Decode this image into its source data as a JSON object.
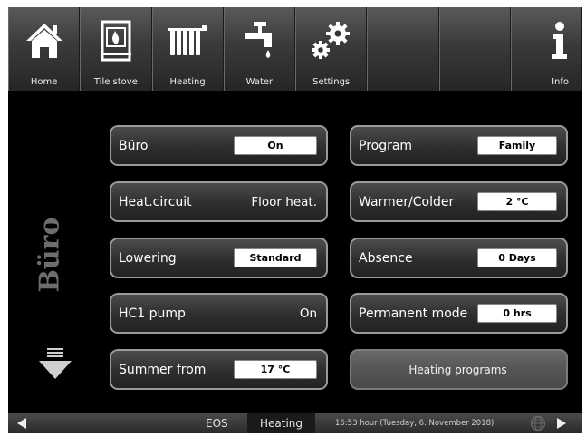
{
  "nav": {
    "items": [
      {
        "label": "Home",
        "icon": "home-icon"
      },
      {
        "label": "Tile stove",
        "icon": "tile-stove-icon"
      },
      {
        "label": "Heating",
        "icon": "radiator-icon"
      },
      {
        "label": "Water",
        "icon": "water-tap-icon"
      },
      {
        "label": "Settings",
        "icon": "gears-icon"
      },
      {
        "label": "",
        "icon": ""
      },
      {
        "label": "",
        "icon": ""
      },
      {
        "label": "Info",
        "icon": "info-icon"
      }
    ]
  },
  "room": {
    "name": "Büro"
  },
  "left_tiles": [
    {
      "label": "Büro",
      "value": "On"
    },
    {
      "label": "Heat.circuit",
      "value": "Floor heat."
    },
    {
      "label": "Lowering",
      "value": "Standard"
    },
    {
      "label": "HC1 pump",
      "value": "On"
    },
    {
      "label": "Summer from",
      "value": "17 °C"
    }
  ],
  "right_tiles": [
    {
      "label": "Program",
      "value": "Family"
    },
    {
      "label": "Warmer/Colder",
      "value": "2 °C"
    },
    {
      "label": "Absence",
      "value": "0 Days"
    },
    {
      "label": "Permanent mode",
      "value": "0 hrs"
    }
  ],
  "action": {
    "label": "Heating programs"
  },
  "status_bar": {
    "eos": "EOS",
    "active_tab": "Heating",
    "datetime": "16:53 hour (Tuesday, 6. November 2018)"
  },
  "colors": {
    "background": "#000000",
    "bar": "#3a3a3a",
    "chip": "#ffffff",
    "text": "#ffffff"
  }
}
